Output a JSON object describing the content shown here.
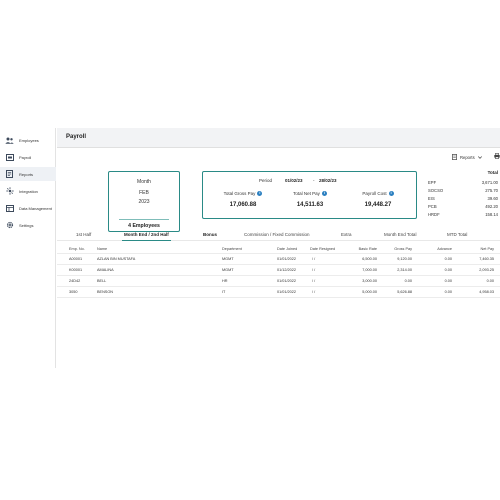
{
  "sidebar": {
    "items": [
      {
        "label": "Employees",
        "icon": "people-icon",
        "active": false
      },
      {
        "label": "Payroll",
        "icon": "payroll-icon",
        "active": false
      },
      {
        "label": "Reports",
        "icon": "report-icon",
        "active": true
      },
      {
        "label": "Integration",
        "icon": "integration-icon",
        "active": false
      },
      {
        "label": "Data Management",
        "icon": "data-management-icon",
        "active": false
      },
      {
        "label": "Settings",
        "icon": "gear-icon",
        "active": false
      }
    ]
  },
  "header": {
    "title": "Payroll"
  },
  "toolbar": {
    "reports_label": "Reports"
  },
  "month_card": {
    "label": "Month",
    "month": "FEB",
    "year": "2023",
    "employees": "4 Employees"
  },
  "summary": {
    "period_label": "Period",
    "period_from": "01/02/23",
    "period_separator": "-",
    "period_to": "28/02/23",
    "gross_label": "Total Gross Pay",
    "gross_value": "17,060.88",
    "net_label": "Total Net Pay",
    "net_value": "14,511.63",
    "cost_label": "Payroll Cost",
    "cost_value": "19,448.27"
  },
  "totals": {
    "header": "Total",
    "rows": [
      {
        "k": "EPF",
        "v": "3,671.00"
      },
      {
        "k": "SOCSO",
        "v": "275.70"
      },
      {
        "k": "EIS",
        "v": "39.60"
      },
      {
        "k": "PCB",
        "v": "492.20"
      },
      {
        "k": "HRDF",
        "v": "158.14"
      }
    ]
  },
  "tabs": [
    "1st Half",
    "Month End / 2nd Half",
    "Bonus",
    "Commission / Fixed Commission",
    "Extra",
    "Month End Total",
    "MTD Total"
  ],
  "table": {
    "columns": [
      "Emp. No.",
      "Name",
      "Department",
      "Date Joined",
      "Date Resigned",
      "Basic Rate",
      "Gross Pay",
      "Advance",
      "Net Pay"
    ],
    "rows": [
      [
        "A00001",
        "AZLAN BIN MUSTAFA",
        "MGMT",
        "01/01/2022",
        "/ /",
        "6,500.00",
        "9,120.00",
        "0.00",
        "7,460.35"
      ],
      [
        "K00001",
        "AMALINA",
        "MGMT",
        "01/12/2022",
        "/ /",
        "7,000.00",
        "2,314.00",
        "0.00",
        "2,093.25"
      ],
      [
        "24D42",
        "BELL",
        "HR",
        "01/01/2022",
        "/ /",
        "3,000.00",
        "0.00",
        "0.00",
        "0.00"
      ],
      [
        "3050",
        "BENSON",
        "IT",
        "01/01/2022",
        "/ /",
        "5,000.00",
        "5,626.88",
        "0.00",
        "4,958.03"
      ]
    ]
  }
}
